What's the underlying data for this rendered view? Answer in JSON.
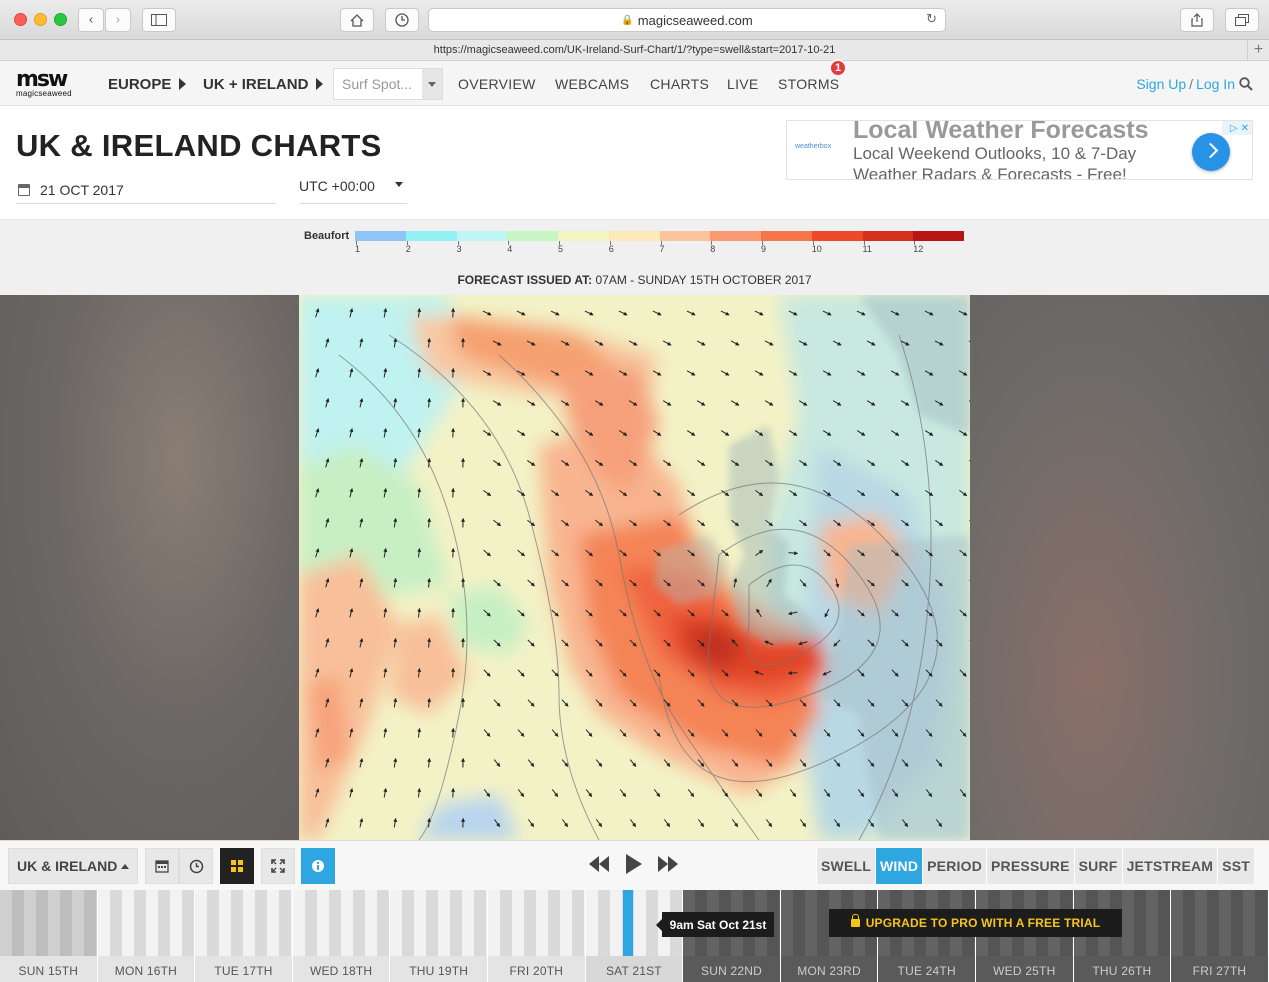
{
  "browser": {
    "domain": "magicseaweed.com",
    "url": "https://magicseaweed.com/UK-Ireland-Surf-Chart/1/?type=swell&start=2017-10-21"
  },
  "nav": {
    "logo_mark": "msw",
    "logo_word": "magicseaweed",
    "breadcrumb": [
      "EUROPE",
      "UK + IRELAND"
    ],
    "spot_placeholder": "Surf Spot...",
    "links": [
      "OVERVIEW",
      "WEBCAMS",
      "CHARTS",
      "LIVE",
      "STORMS"
    ],
    "storms_badge": "1",
    "sign_up": "Sign Up",
    "separator": "/",
    "log_in": "Log In"
  },
  "header": {
    "title": "UK & IRELAND CHARTS",
    "date": "21 OCT 2017",
    "timezone": "UTC +00:00"
  },
  "ad": {
    "brand": "weatherbox",
    "headline": "Local Weather Forecasts",
    "line1": "Local Weekend Outlooks, 10 & 7-Day",
    "line2": "Weather Radars & Forecasts - Free!"
  },
  "legend": {
    "label": "Beaufort",
    "ticks": [
      "1",
      "2",
      "3",
      "4",
      "5",
      "6",
      "7",
      "8",
      "9",
      "10",
      "11",
      "12"
    ],
    "colors": [
      "#8fc5f5",
      "#92f0f2",
      "#bff5f5",
      "#c9f5c4",
      "#f2f5c1",
      "#fde9b9",
      "#fbc39b",
      "#f99a72",
      "#f67449",
      "#ee4a2a",
      "#d4311d",
      "#b71412"
    ]
  },
  "forecast": {
    "prefix": "FORECAST ISSUED AT:",
    "value": "07AM - SUNDAY 15TH OCTOBER 2017"
  },
  "toolbar": {
    "region": "UK & IRELAND",
    "layers": [
      "SWELL",
      "WIND",
      "PERIOD",
      "PRESSURE",
      "SURF",
      "JETSTREAM",
      "SST"
    ],
    "active_layer": "WIND"
  },
  "timeline": {
    "days": [
      "SUN 15TH",
      "MON 16TH",
      "TUE 17TH",
      "WED 18TH",
      "THU 19TH",
      "FRI 20TH",
      "SAT 21ST",
      "SUN 22ND",
      "MON 23RD",
      "TUE 24TH",
      "WED 25TH",
      "THU 26TH",
      "FRI 27TH"
    ],
    "tooltip": "9am Sat Oct 21st",
    "upgrade": "UPGRADE TO PRO WITH A FREE TRIAL"
  },
  "icons": {
    "back": "chevron-left-icon",
    "forward": "chevron-right-icon",
    "home": "home-icon",
    "history": "clock-icon",
    "share": "share-icon",
    "tabs": "tabs-icon",
    "search": "search-icon",
    "calendar": "calendar-icon"
  }
}
